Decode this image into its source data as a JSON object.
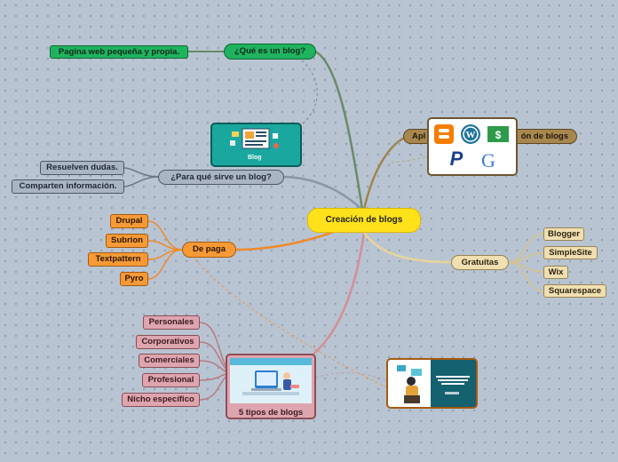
{
  "diagram": {
    "central": "Creación de blogs",
    "que_es": {
      "label": "¿Qué es un blog?",
      "children": [
        "Pagina web pequeña y propia."
      ]
    },
    "para_que": {
      "label": "¿Para qué sirve un blog?",
      "children": [
        "Resuelven dudas.",
        "Comparten información."
      ]
    },
    "de_pago": {
      "label": "De paga",
      "children": [
        "Drupal",
        "Subrion",
        "Textpattern",
        "Pyro"
      ]
    },
    "tipos": {
      "label": "5 tipos de blogs",
      "children": [
        "Personales",
        "Corporativos",
        "Comerciales",
        "Profesional",
        "Nicho específico"
      ]
    },
    "aplicaciones": {
      "label_left": "Apl",
      "label_right": "ón de blogs"
    },
    "gratuitas": {
      "label": "Gratuitas",
      "children": [
        "Blogger",
        "SimpleSite",
        "Wix",
        "Squarespace"
      ]
    }
  },
  "illustrations": {
    "blog_badge": "Blog",
    "app_icons": [
      "blogger-icon",
      "wordpress-icon",
      "dollar-icon",
      "paypal-icon",
      "google-icon"
    ]
  },
  "colors": {
    "green": "#1fb35f",
    "grey": "#a9b5c3",
    "orange": "#f79a36",
    "tan": "#f0dfb0",
    "pink": "#dea5ae",
    "brown": "#a8874f",
    "central": "#ffe21a"
  }
}
